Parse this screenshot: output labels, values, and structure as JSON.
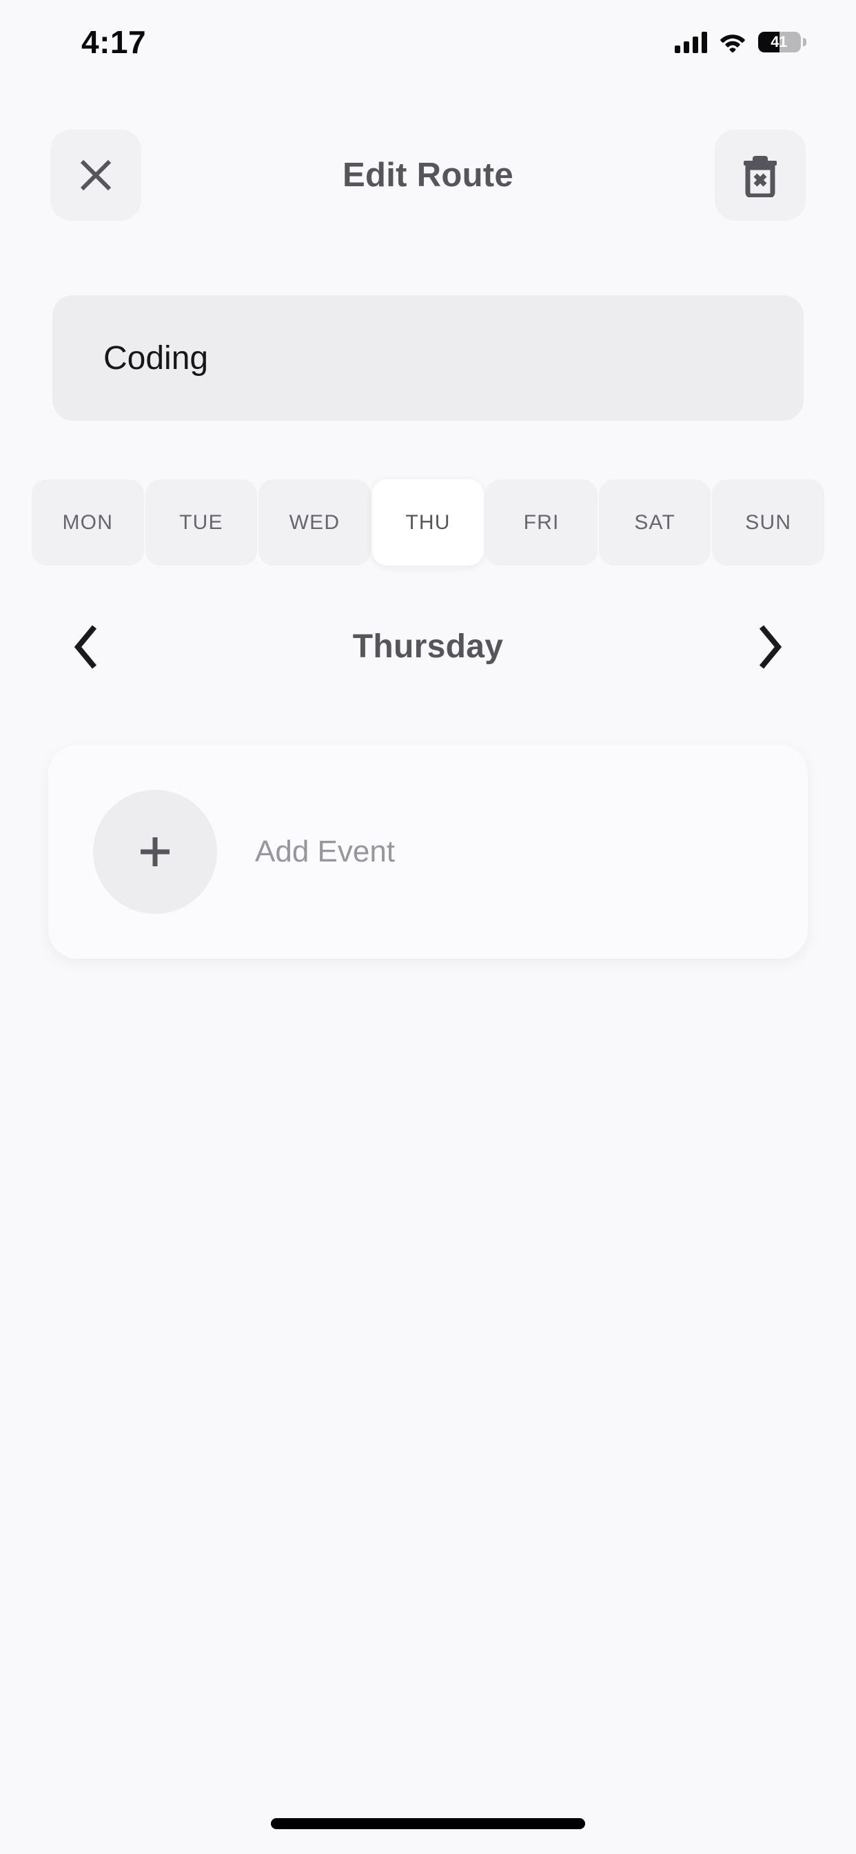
{
  "status_bar": {
    "time": "4:17",
    "signal_icon": "cellular-signal-icon",
    "wifi_icon": "wifi-icon",
    "battery_level": "41",
    "battery_percent": 41
  },
  "header": {
    "title": "Edit Route",
    "close_icon": "close-icon",
    "delete_icon": "trash-delete-icon"
  },
  "route_name": {
    "value": "Coding",
    "placeholder": "Route name"
  },
  "day_tabs": {
    "selected_index": 3,
    "items": [
      {
        "label": "MON",
        "selected": false
      },
      {
        "label": "TUE",
        "selected": false
      },
      {
        "label": "WED",
        "selected": false
      },
      {
        "label": "THU",
        "selected": true
      },
      {
        "label": "FRI",
        "selected": false
      },
      {
        "label": "SAT",
        "selected": false
      },
      {
        "label": "SUN",
        "selected": false
      }
    ]
  },
  "day_nav": {
    "prev_icon": "chevron-left-icon",
    "next_icon": "chevron-right-icon",
    "current_day": "Thursday"
  },
  "events": {
    "add_event_label": "Add Event",
    "add_icon": "plus-icon",
    "list": []
  },
  "colors": {
    "background": "#F9F8FA",
    "surface": "#F1F0F3",
    "input_background": "#EDECEF",
    "card_background": "#FBFAFC",
    "selected_tab": "#FFFFFF",
    "text_primary": "#56555C",
    "text_input": "#17171A",
    "text_muted": "#97969C",
    "tab_text": "#67666D",
    "icon": "#56555C",
    "home_indicator": "#000000"
  }
}
